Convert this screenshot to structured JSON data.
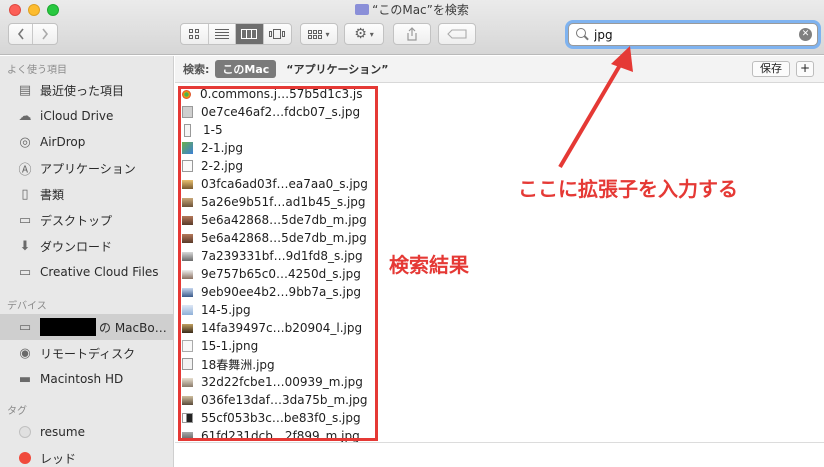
{
  "window": {
    "title": "“このMac”を検索"
  },
  "toolbar": {
    "search_value": "jpg"
  },
  "scope": {
    "label": "検索:",
    "this_mac": "このMac",
    "alt_scope": "“アプリケーション”",
    "save": "保存",
    "add": "+"
  },
  "sidebar": {
    "favorites_heading": "よく使う項目",
    "devices_heading": "デバイス",
    "tags_heading": "タグ",
    "favorites": [
      {
        "label": "最近使った項目",
        "icon": "recents-icon"
      },
      {
        "label": "iCloud Drive",
        "icon": "cloud-icon"
      },
      {
        "label": "AirDrop",
        "icon": "airdrop-icon"
      },
      {
        "label": "アプリケーション",
        "icon": "applications-icon"
      },
      {
        "label": "書類",
        "icon": "documents-icon"
      },
      {
        "label": "デスクトップ",
        "icon": "desktop-icon"
      },
      {
        "label": "ダウンロード",
        "icon": "downloads-icon"
      },
      {
        "label": "Creative Cloud Files",
        "icon": "folder-icon"
      }
    ],
    "devices": [
      {
        "label": "の MacBo…",
        "icon": "laptop-icon"
      },
      {
        "label": "リモートディスク",
        "icon": "disc-icon"
      },
      {
        "label": "Macintosh HD",
        "icon": "harddisk-icon"
      }
    ],
    "tags": [
      {
        "label": "resume",
        "color": "#e0e0e0"
      },
      {
        "label": "レッド",
        "color": "#f04a3c"
      }
    ]
  },
  "results": [
    "0.commons.j…57b5d1c3.js",
    "0e7ce46af2…fdcb07_s.jpg",
    "1-5",
    "2-1.jpg",
    "2-2.jpg",
    "03fca6ad03f…ea7aa0_s.jpg",
    "5a26e9b51f…ad1b45_s.jpg",
    "5e6a42868…5de7db_m.jpg",
    "5e6a42868…5de7db_m.jpg",
    "7a239331bf…9d1fd8_s.jpg",
    "9e757b65c0…4250d_s.jpg",
    "9eb90ee4b2…9bb7a_s.jpg",
    "14-5.jpg",
    "14fa39497c…b20904_l.jpg",
    "15-1.jpng",
    "18春舞洲.jpg",
    "32d22fcbe1…00939_m.jpg",
    "036fe13daf…3da75b_m.jpg",
    "55cf053b3c…be83f0_s.jpg",
    "61fd231dcb…2f899_m.jpg"
  ],
  "annotations": {
    "search_hint": "ここに拡張子を入力する",
    "results_label": "検索結果"
  },
  "colors": {
    "annotation_red": "#e53935",
    "search_focus": "#7fb3f0"
  }
}
